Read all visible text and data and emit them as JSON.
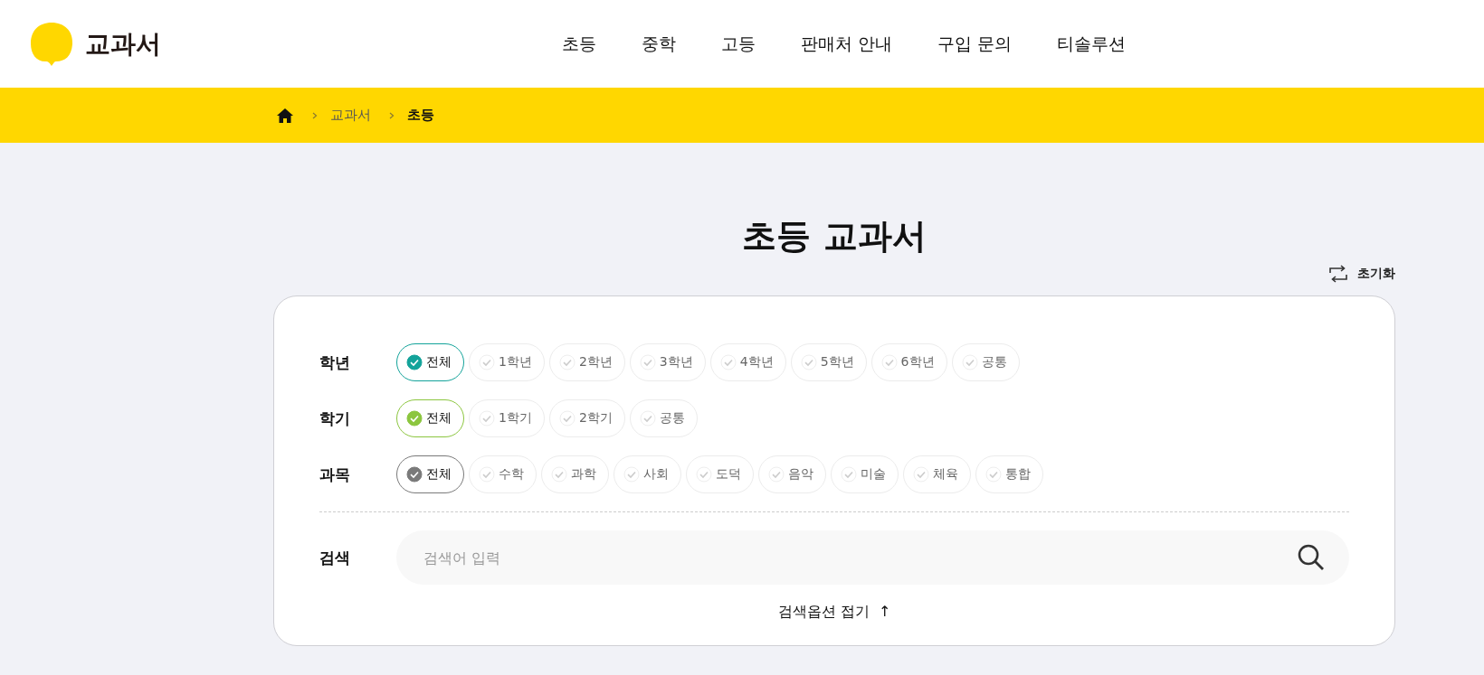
{
  "header": {
    "logo_text": "교과서",
    "nav": [
      {
        "label": "초등",
        "selected": false
      },
      {
        "label": "중학",
        "selected": false
      },
      {
        "label": "고등",
        "selected": false
      },
      {
        "label": "판매처 안내",
        "selected": false
      },
      {
        "label": "구입 문의",
        "selected": false
      },
      {
        "label": "티솔루션",
        "selected": false
      }
    ]
  },
  "breadcrumb": [
    "교과서",
    "초등"
  ],
  "title": "초등 교과서",
  "reset_label": "초기화",
  "filters": [
    {
      "label": "학년",
      "color": "#13a39a",
      "options": [
        {
          "label": "전체",
          "selected": true
        },
        {
          "label": "1학년",
          "selected": false
        },
        {
          "label": "2학년",
          "selected": false
        },
        {
          "label": "3학년",
          "selected": false
        },
        {
          "label": "4학년",
          "selected": false
        },
        {
          "label": "5학년",
          "selected": false
        },
        {
          "label": "6학년",
          "selected": false
        },
        {
          "label": "공통",
          "selected": false
        }
      ]
    },
    {
      "label": "학기",
      "color": "#8cc63f",
      "options": [
        {
          "label": "전체",
          "selected": true
        },
        {
          "label": "1학기",
          "selected": false
        },
        {
          "label": "2학기",
          "selected": false
        },
        {
          "label": "공통",
          "selected": false
        }
      ]
    },
    {
      "label": "과목",
      "color": "#7a7a7a",
      "options": [
        {
          "label": "전체",
          "selected": true
        },
        {
          "label": "수학",
          "selected": false
        },
        {
          "label": "과학",
          "selected": false
        },
        {
          "label": "사회",
          "selected": false
        },
        {
          "label": "도덕",
          "selected": false
        },
        {
          "label": "음악",
          "selected": false
        },
        {
          "label": "미술",
          "selected": false
        },
        {
          "label": "체육",
          "selected": false
        },
        {
          "label": "통합",
          "selected": false
        }
      ]
    }
  ],
  "search": {
    "label": "검색",
    "placeholder": "검색어 입력"
  },
  "collapse": {
    "label": "검색옵션 접기",
    "arrow": "↑"
  }
}
